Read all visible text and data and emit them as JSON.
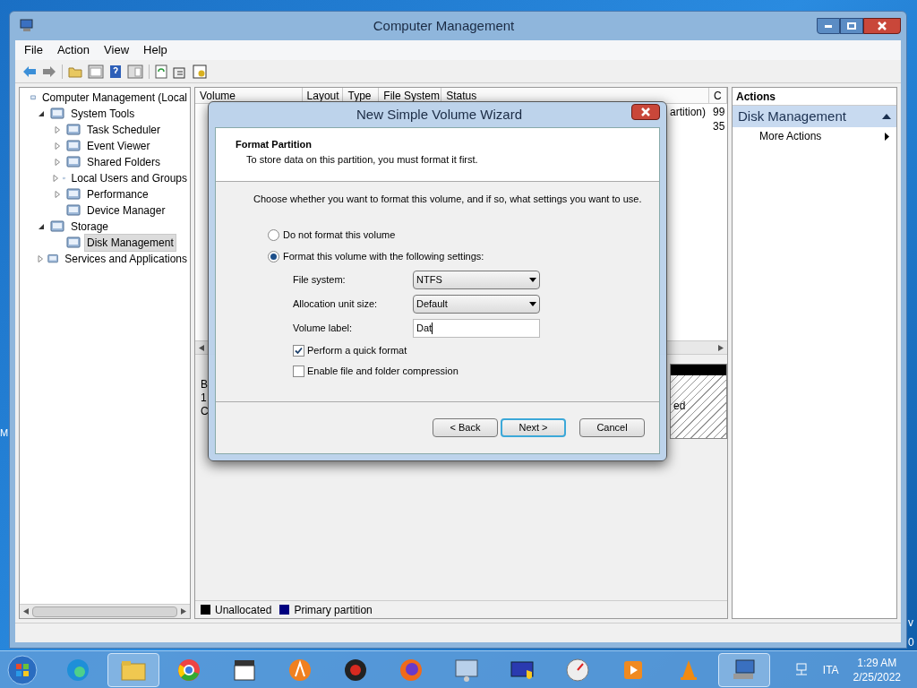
{
  "window": {
    "title": "Computer Management"
  },
  "menu": [
    "File",
    "Action",
    "View",
    "Help"
  ],
  "tree": [
    {
      "label": "Computer Management (Local",
      "kind": "root",
      "selected": false,
      "children": [
        {
          "label": "System Tools",
          "kind": "branch",
          "expanded": true,
          "selected": false,
          "children": [
            {
              "label": "Task Scheduler",
              "kind": "branch",
              "expanded": false,
              "selected": false
            },
            {
              "label": "Event Viewer",
              "kind": "branch",
              "expanded": false,
              "selected": false
            },
            {
              "label": "Shared Folders",
              "kind": "branch",
              "expanded": false,
              "selected": false
            },
            {
              "label": "Local Users and Groups",
              "kind": "branch",
              "expanded": false,
              "selected": false
            },
            {
              "label": "Performance",
              "kind": "branch",
              "expanded": false,
              "selected": false
            },
            {
              "label": "Device Manager",
              "kind": "leaf",
              "selected": false
            }
          ]
        },
        {
          "label": "Storage",
          "kind": "branch",
          "expanded": true,
          "selected": false,
          "children": [
            {
              "label": "Disk Management",
              "kind": "leaf",
              "selected": true
            }
          ]
        },
        {
          "label": "Services and Applications",
          "kind": "branch",
          "expanded": false,
          "selected": false
        }
      ]
    }
  ],
  "table": {
    "columns": [
      "Volume",
      "Layout",
      "Type",
      "File System",
      "Status",
      "C"
    ],
    "visible_cells": [
      {
        "status": "artition)",
        "column_6": "99"
      },
      {
        "column_6": "35"
      }
    ]
  },
  "disk_pane": {
    "fragments": [
      "B",
      "1",
      "C"
    ],
    "partition_text": "ed"
  },
  "legend": [
    {
      "label": "Unallocated",
      "color": "#000000"
    },
    {
      "label": "Primary partition",
      "color": "#00007f"
    }
  ],
  "actions": {
    "title": "Actions",
    "section": "Disk Management",
    "items": [
      "More Actions"
    ]
  },
  "dialog": {
    "title": "New Simple Volume Wizard",
    "heading": "Format Partition",
    "subheading": "To store data on this partition, you must format it first.",
    "prompt": "Choose whether you want to format this volume, and if so, what settings you want to use.",
    "options": [
      {
        "label": "Do not format this volume",
        "selected": false
      },
      {
        "label": "Format this volume with the following settings:",
        "selected": true
      }
    ],
    "fields": [
      {
        "kind": "dropdown",
        "label": "File system:",
        "value": "NTFS"
      },
      {
        "kind": "dropdown",
        "label": "Allocation unit size:",
        "value": "Default"
      },
      {
        "kind": "text",
        "label": "Volume label:",
        "value": "Dat"
      }
    ],
    "checkboxes": [
      {
        "label": "Perform a quick format",
        "checked": true
      },
      {
        "label": "Enable file and folder compression",
        "checked": false
      }
    ],
    "buttons": [
      {
        "label": "< Back",
        "default": false
      },
      {
        "label": "Next >",
        "default": true
      },
      {
        "label": "Cancel",
        "default": false
      }
    ]
  },
  "desktop": {
    "left_label": "M",
    "right_labels": [
      "v",
      "0"
    ]
  },
  "tray": {
    "language": "ITA",
    "time": "1:29 AM",
    "date": "2/25/2022"
  }
}
